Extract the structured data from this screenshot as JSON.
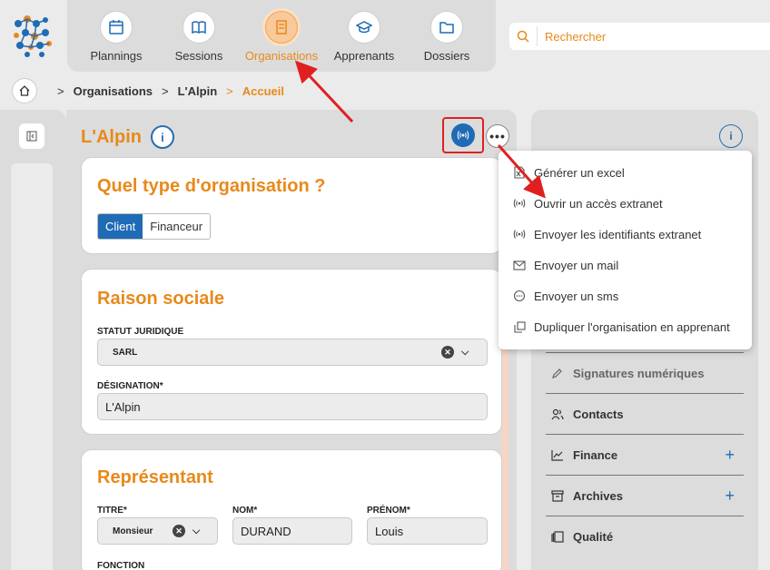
{
  "nav": {
    "items": [
      {
        "label": "Plannings",
        "icon": "calendar-icon"
      },
      {
        "label": "Sessions",
        "icon": "book-icon"
      },
      {
        "label": "Organisations",
        "icon": "building-icon"
      },
      {
        "label": "Apprenants",
        "icon": "graduation-cap-icon"
      },
      {
        "label": "Dossiers",
        "icon": "folder-icon"
      }
    ],
    "active": "Organisations"
  },
  "search": {
    "placeholder": "Rechercher"
  },
  "breadcrumb": {
    "items": [
      "Organisations",
      "L'Alpin",
      "Accueil"
    ]
  },
  "page": {
    "title": "L'Alpin"
  },
  "type_card": {
    "title": "Quel type d'organisation ?",
    "options": [
      "Client",
      "Financeur"
    ],
    "selected": "Client"
  },
  "raison_card": {
    "title": "Raison sociale",
    "statut_label": "STATUT JURIDIQUE",
    "statut_value": "SARL",
    "designation_label": "DÉSIGNATION*",
    "designation_value": "L'Alpin"
  },
  "rep_card": {
    "title": "Représentant",
    "titre_label": "TITRE*",
    "titre_value": "Monsieur",
    "nom_label": "NOM*",
    "nom_value": "DURAND",
    "prenom_label": "PRÉNOM*",
    "prenom_value": "Louis",
    "fonction_label": "FONCTION"
  },
  "menu": {
    "items": [
      {
        "label": "Générer un excel",
        "icon": "excel-file-icon"
      },
      {
        "label": "Ouvrir un accès extranet",
        "icon": "broadcast-icon"
      },
      {
        "label": "Envoyer les identifiants extranet",
        "icon": "broadcast-icon"
      },
      {
        "label": "Envoyer un mail",
        "icon": "envelope-icon"
      },
      {
        "label": "Envoyer un sms",
        "icon": "chat-icon"
      },
      {
        "label": "Dupliquer l'organisation en apprenant",
        "icon": "duplicate-icon"
      }
    ]
  },
  "side": {
    "items": [
      {
        "label": "Signatures numériques",
        "icon": "pen-icon"
      },
      {
        "label": "Contacts",
        "icon": "users-icon"
      },
      {
        "label": "Finance",
        "icon": "chart-line-icon",
        "plus": "+"
      },
      {
        "label": "Archives",
        "icon": "archive-icon",
        "plus": "+"
      },
      {
        "label": "Qualité",
        "icon": "quality-icon"
      }
    ]
  },
  "colors": {
    "accent": "#e8891a",
    "primary": "#1f6bb5",
    "annotation": "#e02020"
  }
}
